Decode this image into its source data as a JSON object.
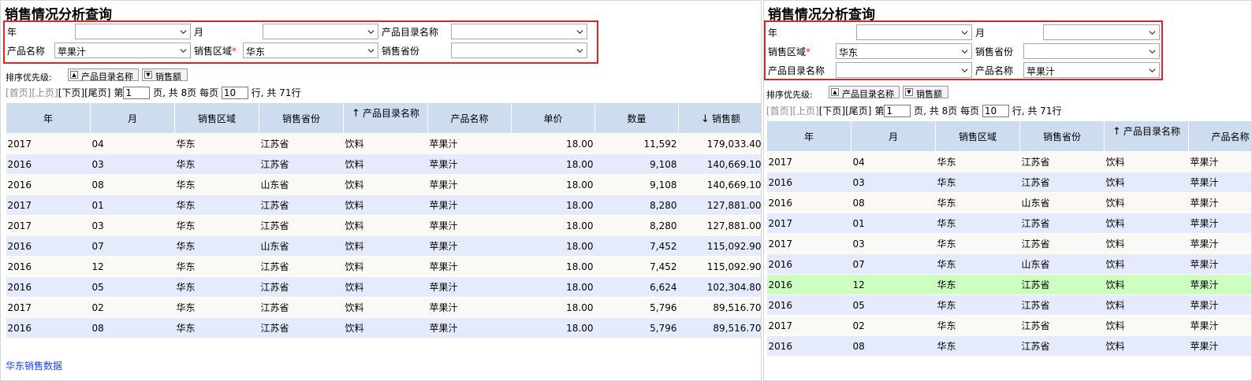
{
  "title": "销售情况分析查询",
  "labels": {
    "year": "年",
    "month": "月",
    "catalog": "产品目录名称",
    "product": "产品名称",
    "region": "销售区域",
    "province": "销售省份",
    "required_mark": "*"
  },
  "filters": {
    "year": "",
    "month": "",
    "catalog": "",
    "product": "苹果汁",
    "region": "华东",
    "province": ""
  },
  "sort": {
    "label": "排序优先级:",
    "fields": [
      {
        "label": "产品目录名称",
        "icon": "arrow-up-icon"
      },
      {
        "label": "销售额",
        "icon": "arrow-down-icon"
      }
    ]
  },
  "pager": {
    "first": "[首页]",
    "prev": "[上页]",
    "next": "[下页]",
    "last": "[尾页]",
    "page_prefix": "第",
    "page_value": "1",
    "total_pages_text": "页, 共 8页 每页",
    "page_size": "10",
    "total_rows_text": "行, 共 71行"
  },
  "table": {
    "columns": [
      "年",
      "月",
      "销售区域",
      "销售省份",
      "产品目录名称",
      "产品名称",
      "单价",
      "数量",
      "销售额"
    ],
    "sort_up_column": "产品目录名称",
    "sort_down_column": "销售额",
    "rows": [
      [
        "2017",
        "04",
        "华东",
        "江苏省",
        "饮料",
        "苹果汁",
        "18.00",
        "11,592",
        "179,033.40"
      ],
      [
        "2016",
        "03",
        "华东",
        "江苏省",
        "饮料",
        "苹果汁",
        "18.00",
        "9,108",
        "140,669.10"
      ],
      [
        "2016",
        "08",
        "华东",
        "山东省",
        "饮料",
        "苹果汁",
        "18.00",
        "9,108",
        "140,669.10"
      ],
      [
        "2017",
        "01",
        "华东",
        "江苏省",
        "饮料",
        "苹果汁",
        "18.00",
        "8,280",
        "127,881.00"
      ],
      [
        "2017",
        "03",
        "华东",
        "江苏省",
        "饮料",
        "苹果汁",
        "18.00",
        "8,280",
        "127,881.00"
      ],
      [
        "2016",
        "07",
        "华东",
        "山东省",
        "饮料",
        "苹果汁",
        "18.00",
        "7,452",
        "115,092.90"
      ],
      [
        "2016",
        "12",
        "华东",
        "江苏省",
        "饮料",
        "苹果汁",
        "18.00",
        "7,452",
        "115,092.90"
      ],
      [
        "2016",
        "05",
        "华东",
        "江苏省",
        "饮料",
        "苹果汁",
        "18.00",
        "6,624",
        "102,304.80"
      ],
      [
        "2017",
        "02",
        "华东",
        "江苏省",
        "饮料",
        "苹果汁",
        "18.00",
        "5,796",
        "89,516.70"
      ],
      [
        "2016",
        "08",
        "华东",
        "江苏省",
        "饮料",
        "苹果汁",
        "18.00",
        "5,796",
        "89,516.70"
      ]
    ]
  },
  "highlighted_row_index_right": 6,
  "footer_link": "华东销售数据",
  "colors": {
    "header_bg": "#cddcef",
    "row_odd": "#faf9f6",
    "row_even": "#e5ebfd",
    "row_highlight": "#ccffc0",
    "filter_border": "#e52222",
    "link": "#1a3cff"
  }
}
